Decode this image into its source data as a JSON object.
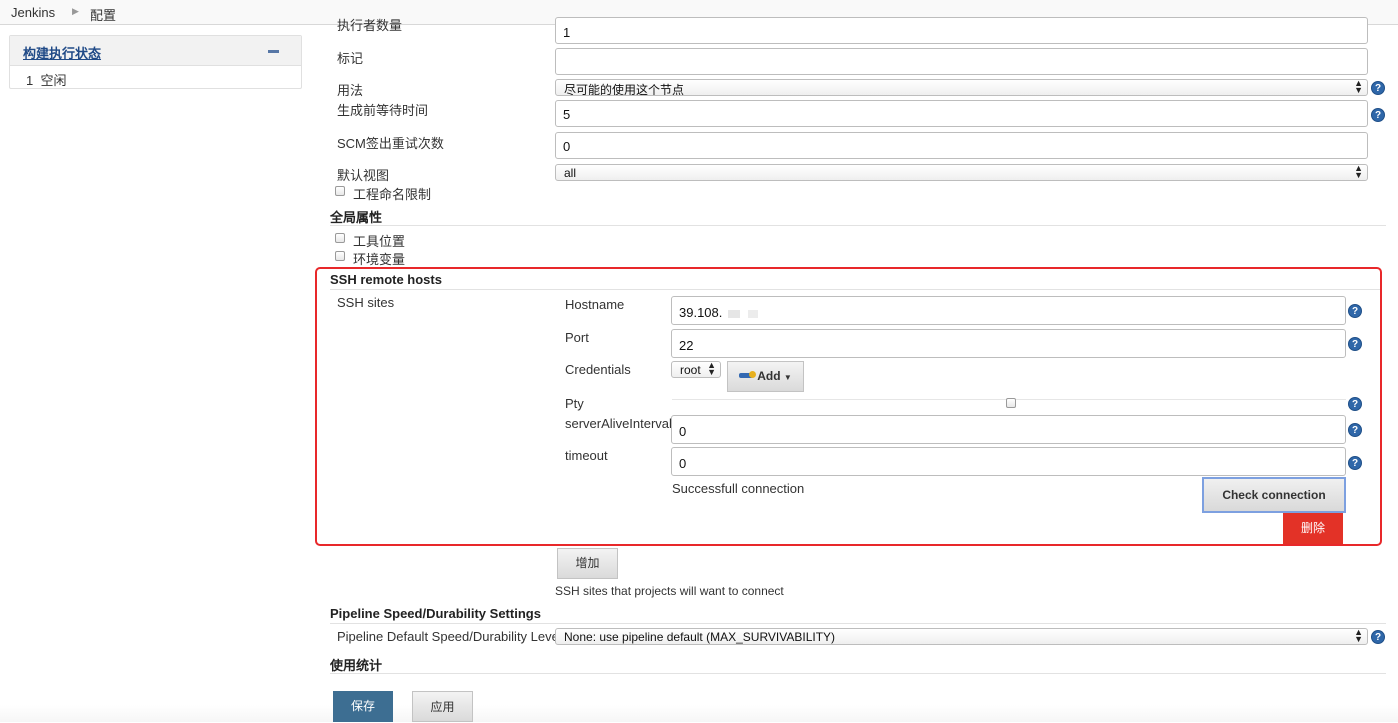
{
  "breadcrumb": {
    "root": "Jenkins",
    "current": "配置"
  },
  "side_panel": {
    "title": "构建执行状态",
    "executor_number": "1",
    "executor_status": "空闲"
  },
  "config": {
    "executors_label": "执行者数量",
    "executors_value": "1",
    "labels_label": "标记",
    "labels_value": "",
    "usage_label": "用法",
    "usage_value": "尽可能的使用这个节点",
    "quiet_period_label": "生成前等待时间",
    "quiet_period_value": "5",
    "scm_retry_label": "SCM签出重试次数",
    "scm_retry_value": "0",
    "default_view_label": "默认视图",
    "default_view_value": "all",
    "project_naming_label": "工程命名限制"
  },
  "global_properties": {
    "heading": "全局属性",
    "tool_locations_label": "工具位置",
    "env_vars_label": "环境变量"
  },
  "ssh": {
    "heading": "SSH remote hosts",
    "sites_label": "SSH sites",
    "hostname_label": "Hostname",
    "hostname_value": "39.108.",
    "port_label": "Port",
    "port_value": "22",
    "credentials_label": "Credentials",
    "credentials_value": "root",
    "add_label": "Add",
    "pty_label": "Pty",
    "server_alive_label": "serverAliveInterval",
    "server_alive_value": "0",
    "timeout_label": "timeout",
    "timeout_value": "0",
    "status_text": "Successfull connection",
    "check_button": "Check connection",
    "delete_button": "删除",
    "add_site_button": "增加",
    "hint": "SSH sites that projects will want to connect"
  },
  "pipeline": {
    "heading": "Pipeline Speed/Durability Settings",
    "level_label": "Pipeline Default Speed/Durability Level",
    "level_value": "None: use pipeline default (MAX_SURVIVABILITY)"
  },
  "usage_stats": {
    "heading": "使用统计"
  },
  "footer": {
    "save": "保存",
    "apply": "应用"
  },
  "colors": {
    "accent": "#3d6e92",
    "danger": "#e33227",
    "highlight_border": "#e8282a",
    "help": "#2f67a9"
  }
}
